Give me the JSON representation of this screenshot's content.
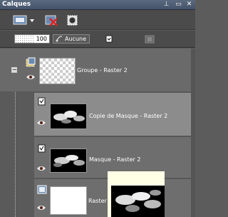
{
  "window": {
    "title": "Calques"
  },
  "options": {
    "opacity": "100",
    "blend_mode": "Aucune"
  },
  "layers": [
    {
      "name": "Groupe - Raster 2"
    },
    {
      "name": "Copie de Masque - Raster 2"
    },
    {
      "name": "Masque - Raster 2"
    },
    {
      "name": "Raster"
    }
  ],
  "colors": {
    "title_bar": "#4f5d72",
    "selected_row": "#8c8c8c",
    "panel": "#5a5a5a",
    "preview_bg": "#ffffe6"
  }
}
